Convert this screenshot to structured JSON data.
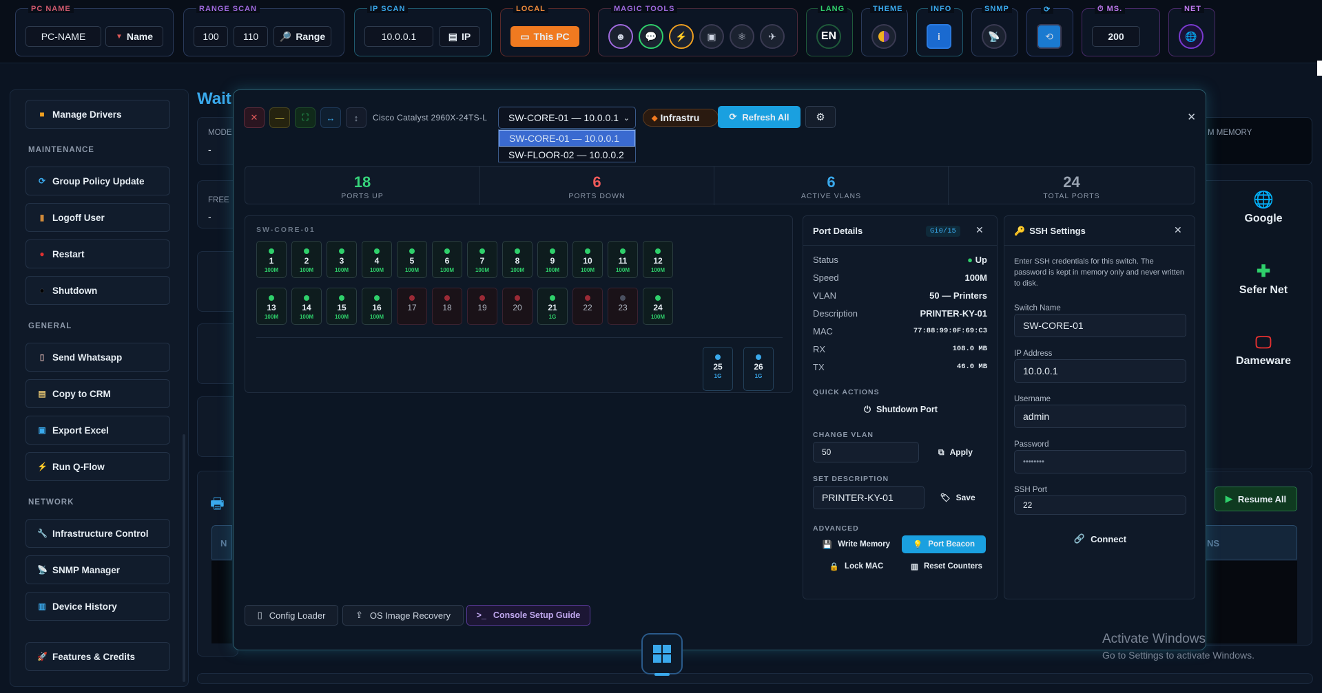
{
  "topbar": {
    "pc_name": {
      "label": "PC NAME",
      "value": "PC-NAME",
      "button": "Name"
    },
    "range_scan": {
      "label": "RANGE SCAN",
      "from": "100",
      "to": "110",
      "button": "Range"
    },
    "ip_scan": {
      "label": "IP SCAN",
      "value": "10.0.0.1",
      "button": "IP"
    },
    "local": {
      "label": "LOCAL",
      "button": "This PC"
    },
    "magic_tools": {
      "label": "MAGIC TOOLS",
      "icons": [
        "robot-icon",
        "chat-icon",
        "bolt-icon",
        "camera-icon",
        "atom-icon",
        "satellite-icon"
      ]
    },
    "lang": {
      "label": "LANG",
      "value": "EN"
    },
    "theme": {
      "label": "THEME"
    },
    "info": {
      "label": "INFO"
    },
    "snmp": {
      "label": "SNMP"
    },
    "ms": {
      "label": "MS.",
      "value": "200"
    },
    "net": {
      "label": "NET"
    }
  },
  "sidebar": {
    "manage_drivers": "Manage Drivers",
    "maintenance_header": "MAINTENANCE",
    "maintenance": [
      "Group Policy Update",
      "Logoff User",
      "Restart",
      "Shutdown"
    ],
    "general_header": "GENERAL",
    "general": [
      "Send Whatsapp",
      "Copy to CRM",
      "Export Excel",
      "Run Q-Flow"
    ],
    "network_header": "NETWORK",
    "network": [
      "Infrastructure Control",
      "SNMP Manager",
      "Device History"
    ],
    "features": "Features & Credits"
  },
  "background": {
    "title_fragment": "Wait",
    "model_label": "MODE",
    "model_value": "-",
    "free_label": "FREE",
    "free_value": "-",
    "memory_label": "M MEMORY",
    "table_header_left": "N",
    "table_header_right": "NS",
    "resume_all": "Resume All",
    "shortcuts": [
      "Google",
      "Sefer Net",
      "Dameware"
    ]
  },
  "modal": {
    "device_model": "Cisco Catalyst 2960X-24TS-L",
    "selected_switch": "SW-CORE-01 — 10.0.0.1",
    "switch_options": [
      "SW-CORE-01 — 10.0.0.1",
      "SW-FLOOR-02 — 10.0.0.2"
    ],
    "tag": "Infrastru",
    "refresh_all": "Refresh All",
    "stats": [
      {
        "value": "18",
        "label": "PORTS UP",
        "color": "#36d37a"
      },
      {
        "value": "6",
        "label": "PORTS DOWN",
        "color": "#ef5a5a"
      },
      {
        "value": "6",
        "label": "ACTIVE VLANS",
        "color": "#3aa9ec"
      },
      {
        "value": "24",
        "label": "TOTAL PORTS",
        "color": "#9aa4b2"
      }
    ],
    "switch_name": "SW-CORE-01",
    "ports_row1": [
      {
        "n": "1",
        "s": "100M",
        "st": "up"
      },
      {
        "n": "2",
        "s": "100M",
        "st": "up"
      },
      {
        "n": "3",
        "s": "100M",
        "st": "up"
      },
      {
        "n": "4",
        "s": "100M",
        "st": "up"
      },
      {
        "n": "5",
        "s": "100M",
        "st": "up"
      },
      {
        "n": "6",
        "s": "100M",
        "st": "up"
      },
      {
        "n": "7",
        "s": "100M",
        "st": "up"
      },
      {
        "n": "8",
        "s": "100M",
        "st": "up"
      },
      {
        "n": "9",
        "s": "100M",
        "st": "up"
      },
      {
        "n": "10",
        "s": "100M",
        "st": "up"
      },
      {
        "n": "11",
        "s": "100M",
        "st": "up"
      },
      {
        "n": "12",
        "s": "100M",
        "st": "up"
      }
    ],
    "ports_row2": [
      {
        "n": "13",
        "s": "100M",
        "st": "up"
      },
      {
        "n": "14",
        "s": "100M",
        "st": "up"
      },
      {
        "n": "15",
        "s": "100M",
        "st": "up"
      },
      {
        "n": "16",
        "s": "100M",
        "st": "up"
      },
      {
        "n": "17",
        "s": "",
        "st": "down"
      },
      {
        "n": "18",
        "s": "",
        "st": "down"
      },
      {
        "n": "19",
        "s": "",
        "st": "down"
      },
      {
        "n": "20",
        "s": "",
        "st": "down"
      },
      {
        "n": "21",
        "s": "1G",
        "st": "up"
      },
      {
        "n": "22",
        "s": "",
        "st": "down"
      },
      {
        "n": "23",
        "s": "",
        "st": "off"
      },
      {
        "n": "24",
        "s": "100M",
        "st": "up"
      }
    ],
    "uplinks": [
      {
        "n": "25",
        "s": "1G"
      },
      {
        "n": "26",
        "s": "1G"
      }
    ],
    "port_details": {
      "title": "Port Details",
      "badge": "Gi0/15",
      "rows": [
        {
          "k": "Status",
          "v": "Up"
        },
        {
          "k": "Speed",
          "v": "100M"
        },
        {
          "k": "VLAN",
          "v": "50 — Printers"
        },
        {
          "k": "Description",
          "v": "PRINTER-KY-01"
        },
        {
          "k": "MAC",
          "v": "77:88:99:0F:69:C3"
        },
        {
          "k": "RX",
          "v": "108.0 MB"
        },
        {
          "k": "TX",
          "v": "46.0 MB"
        }
      ],
      "quick_actions": "QUICK ACTIONS",
      "shutdown_port": "Shutdown Port",
      "change_vlan": "CHANGE VLAN",
      "vlan_value": "50",
      "apply": "Apply",
      "set_description": "SET DESCRIPTION",
      "description_value": "PRINTER-KY-01",
      "save": "Save",
      "advanced": "ADVANCED",
      "write_memory": "Write Memory",
      "port_beacon": "Port Beacon",
      "lock_mac": "Lock MAC",
      "reset_counters": "Reset Counters"
    },
    "ssh": {
      "title": "SSH Settings",
      "description": "Enter SSH credentials for this switch. The password is kept in memory only and never written to disk.",
      "switch_name_label": "Switch Name",
      "switch_name": "SW-CORE-01",
      "ip_label": "IP Address",
      "ip": "10.0.0.1",
      "username_label": "Username",
      "username": "admin",
      "password_label": "Password",
      "password": "••••••••",
      "port_label": "SSH Port",
      "port": "22",
      "connect": "Connect"
    },
    "bottom": {
      "config_loader": "Config Loader",
      "os_recovery": "OS Image Recovery",
      "console_guide": "Console Setup Guide"
    }
  },
  "watermark": {
    "line1": "Activate Windows",
    "line2": "Go to Settings to activate Windows."
  }
}
